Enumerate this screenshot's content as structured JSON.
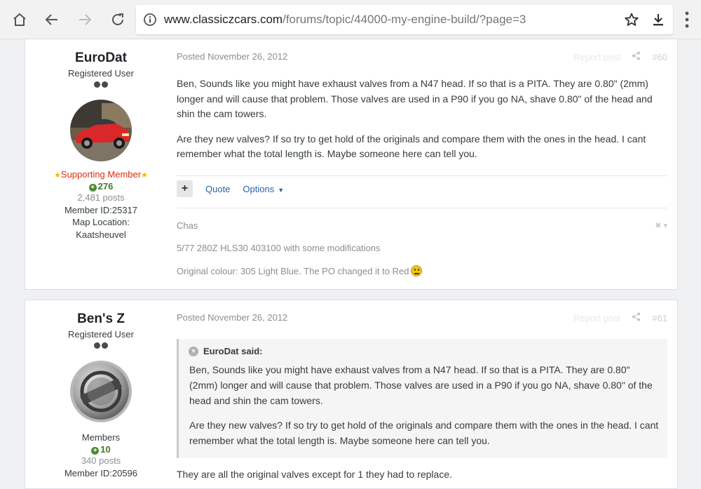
{
  "browser": {
    "url_host": "www.classiczcars.com",
    "url_path": "/forums/topic/44000-my-engine-build/?page=3"
  },
  "posts": [
    {
      "author": "EuroDat",
      "role": "Registered User",
      "group": "Supporting Member",
      "reputation": "276",
      "posts": "2,481 posts",
      "member_id": "Member ID:25317",
      "location_label": "Map Location:",
      "location": "Kaatsheuvel",
      "posted": "Posted November 26, 2012",
      "report": "Report post",
      "number": "#60",
      "paragraphs": [
        "Ben, Sounds like you might have exhaust valves from a N47 head. If so that is a PITA. They are 0.80\" (2mm) longer and will cause that problem. Those valves are used in a P90 if you go NA, shave 0.80\" of the head and shin the cam towers.",
        "Are they new valves? If so try to get hold of the originals and compare them with the ones in the head. I cant remember what the total length is. Maybe someone here can tell you."
      ],
      "actions": {
        "quote": "Quote",
        "options": "Options"
      },
      "signature": [
        "Chas",
        "5/77 280Z HLS30 403100 with some modifications",
        "Original colour: 305 Light Blue. The PO changed it to Red"
      ]
    },
    {
      "author": "Ben's Z",
      "role": "Registered User",
      "group": "Members",
      "reputation": "10",
      "posts": "340 posts",
      "member_id": "Member ID:20596",
      "posted": "Posted November 26, 2012",
      "report": "Report post",
      "number": "#61",
      "quote_author": "EuroDat said:",
      "quote_paragraphs": [
        "Ben, Sounds like you might have exhaust valves from a N47 head. If so that is a PITA. They are 0.80\" (2mm) longer and will cause that problem. Those valves are used in a P90 if you go NA, shave 0.80\" of the head and shin the cam towers.",
        "Are they new valves? If so try to get hold of the originals and compare them with the ones in the head. I cant remember what the total length is. Maybe someone here can tell you."
      ],
      "reply": "They are all the original valves except for 1 they had to replace."
    }
  ],
  "colors": {
    "link": "#2a64a8",
    "supporting": "#e4290a",
    "reputation": "#3e7a28"
  }
}
